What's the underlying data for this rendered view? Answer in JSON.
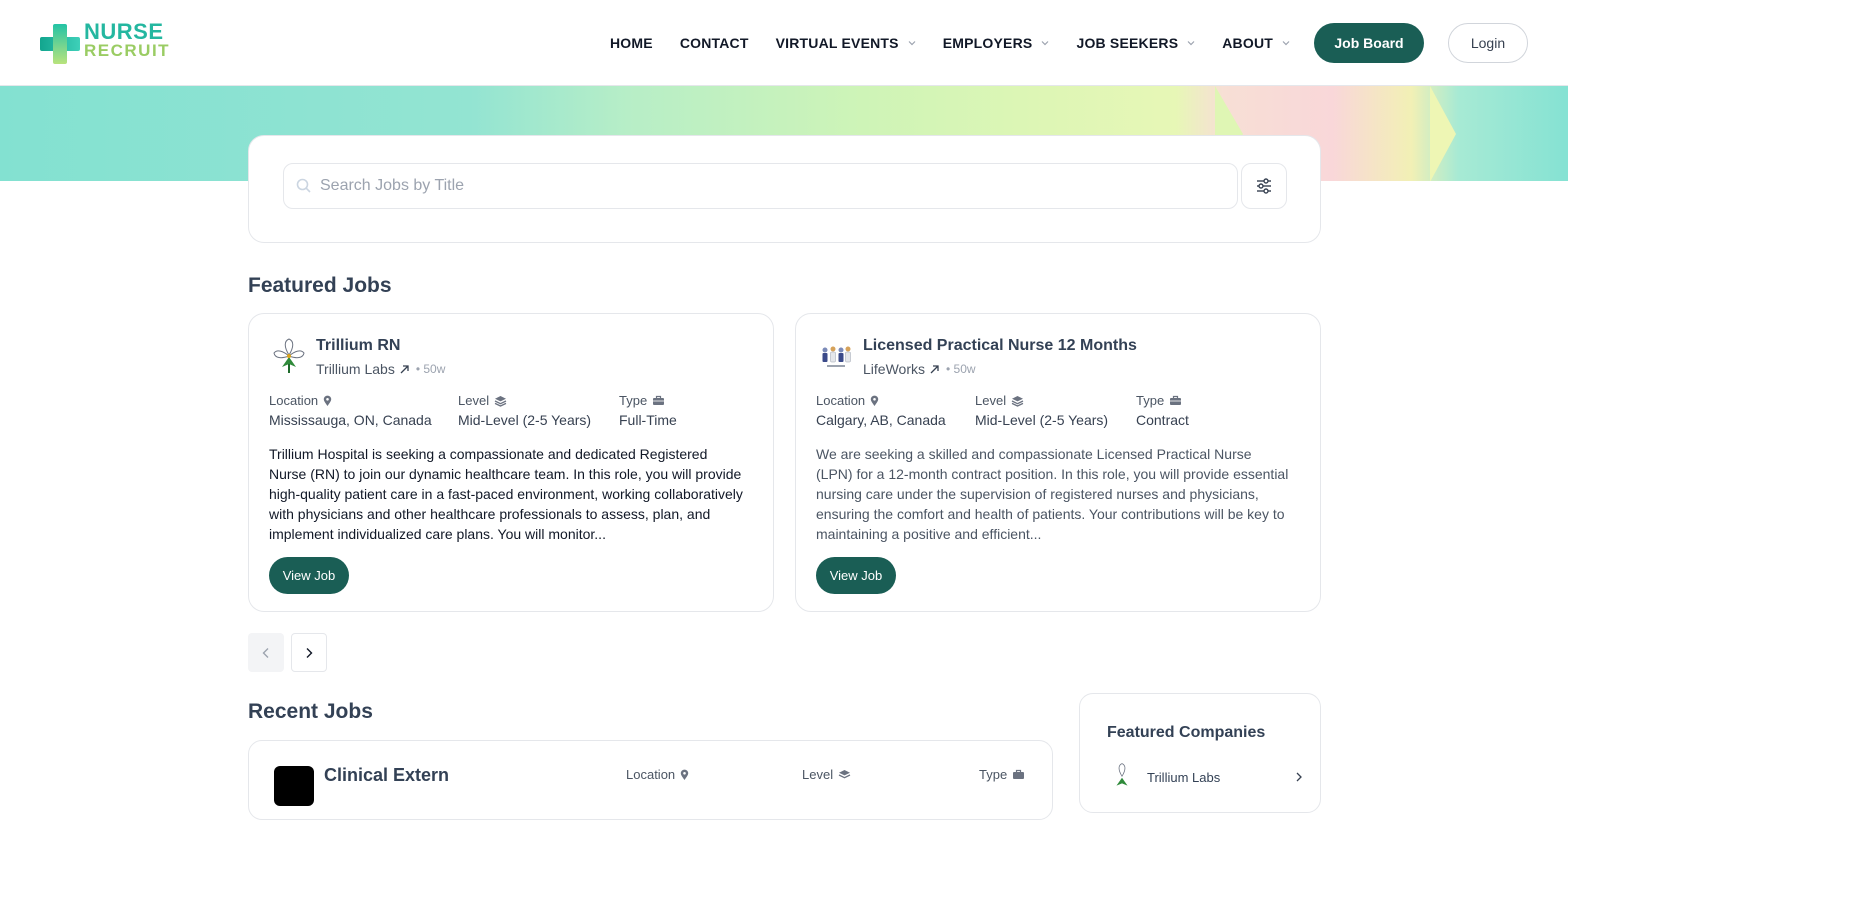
{
  "brand": {
    "line1": "NURSE",
    "line2": "RECRUIT"
  },
  "nav": {
    "items": [
      {
        "label": "HOME",
        "dropdown": false
      },
      {
        "label": "CONTACT",
        "dropdown": false
      },
      {
        "label": "VIRTUAL EVENTS",
        "dropdown": true
      },
      {
        "label": "EMPLOYERS",
        "dropdown": true
      },
      {
        "label": "JOB SEEKERS",
        "dropdown": true
      },
      {
        "label": "ABOUT",
        "dropdown": true
      }
    ],
    "job_board_label": "Job Board",
    "login_label": "Login"
  },
  "search": {
    "placeholder": "Search Jobs by Title",
    "value": ""
  },
  "featured": {
    "heading": "Featured Jobs",
    "meta_labels": {
      "location": "Location",
      "level": "Level",
      "type": "Type"
    },
    "view_label": "View Job",
    "jobs": [
      {
        "title": "Trillium RN",
        "company": "Trillium Labs",
        "age": "• 50w",
        "location": "Mississauga, ON, Canada",
        "level": "Mid-Level (2-5 Years)",
        "type": "Full-Time",
        "description": "Trillium Hospital is seeking a compassionate and dedicated Registered Nurse (RN) to join our dynamic healthcare team. In this role, you will provide high-quality patient care in a fast-paced environment, working collaboratively with physicians and other healthcare professionals to assess, plan, and implement individualized care plans. You will monitor..."
      },
      {
        "title": "Licensed Practical Nurse 12 Months",
        "company": "LifeWorks",
        "age": "• 50w",
        "location": "Calgary, AB, Canada",
        "level": "Mid-Level (2-5 Years)",
        "type": "Contract",
        "description": "We are seeking a skilled and compassionate Licensed Practical Nurse (LPN) for a 12-month contract position. In this role, you will provide essential nursing care under the supervision of registered nurses and physicians, ensuring the comfort and health of patients. Your contributions will be key to maintaining a positive and efficient..."
      }
    ]
  },
  "recent": {
    "heading": "Recent Jobs",
    "first_title": "Clinical Extern",
    "meta_labels": {
      "location": "Location",
      "level": "Level",
      "type": "Type"
    }
  },
  "companies": {
    "heading": "Featured Companies",
    "first": "Trillium Labs"
  },
  "colors": {
    "primary": "#1a5e55",
    "brand_teal": "#24b7a0",
    "brand_green": "#9acc63"
  },
  "icons": [
    "search-icon",
    "filter-icon",
    "location-pin-icon",
    "layers-icon",
    "briefcase-icon",
    "external-arrow-icon",
    "chevron-left-icon",
    "chevron-right-icon",
    "chevron-down-icon"
  ]
}
